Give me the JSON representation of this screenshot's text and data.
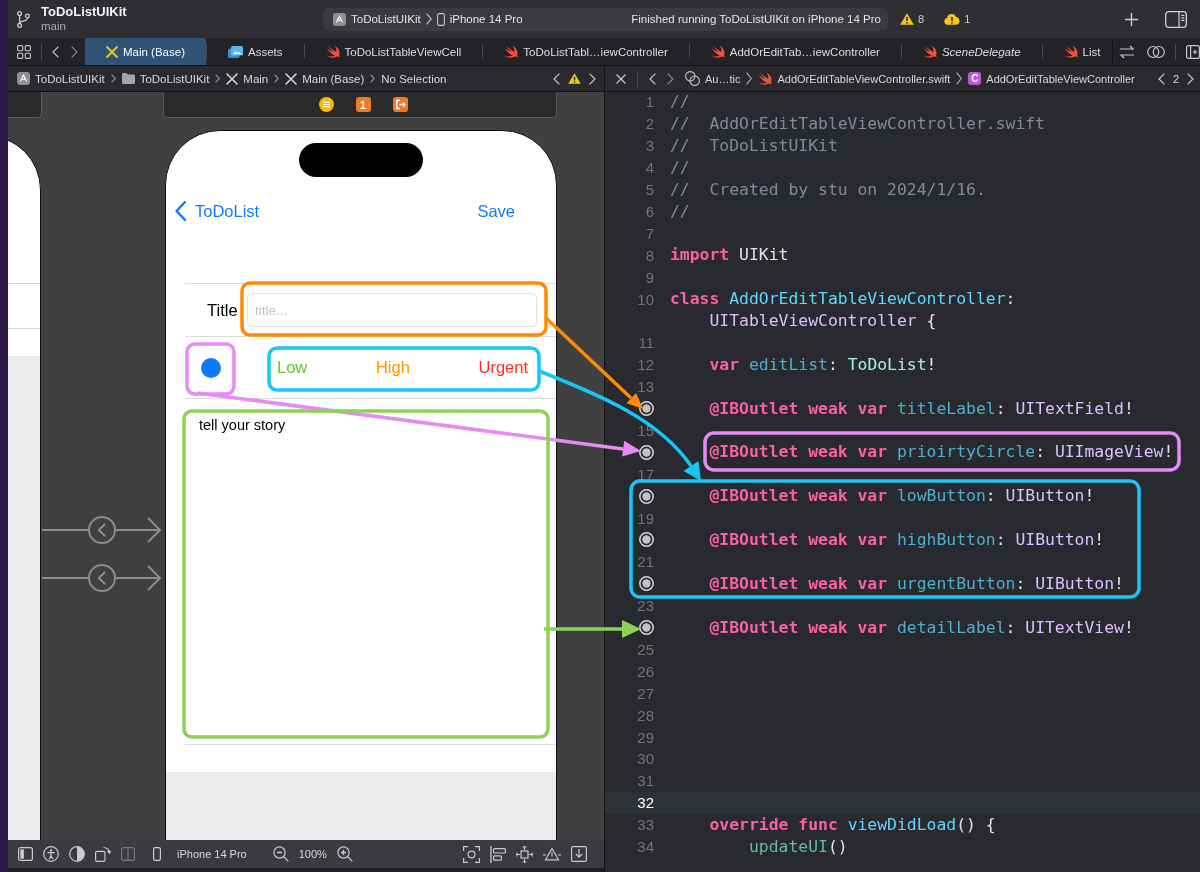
{
  "toolbar": {
    "project": "ToDoListUIKit",
    "branch": "main",
    "scheme": "ToDoListUIKit",
    "device": "iPhone 14 Pro",
    "status": "Finished running ToDoListUIKit on iPhone 14 Pro",
    "warnings": "8",
    "issues": "1"
  },
  "tabs": [
    {
      "label": "Main (Base)",
      "kind": "storyboard",
      "selected": true,
      "preview": false
    },
    {
      "label": "Assets",
      "kind": "assets",
      "selected": false,
      "preview": false
    },
    {
      "label": "ToDoListTableViewCell",
      "kind": "swift",
      "selected": false,
      "preview": false
    },
    {
      "label": "ToDoListTabl…iewController",
      "kind": "swift",
      "selected": false,
      "preview": false
    },
    {
      "label": "AddOrEditTab…iewController",
      "kind": "swift",
      "selected": false,
      "preview": false
    },
    {
      "label": "SceneDelegate",
      "kind": "swift",
      "selected": false,
      "preview": true
    },
    {
      "label": "List",
      "kind": "swift",
      "selected": false,
      "preview": false
    }
  ],
  "canvas_jump_bar": {
    "path": [
      {
        "kind": "app",
        "label": "ToDoListUIKit"
      },
      {
        "kind": "folder",
        "label": "ToDoListUIKit"
      },
      {
        "kind": "storyboard",
        "label": "Main"
      },
      {
        "kind": "storyboard",
        "label": "Main (Base)"
      },
      {
        "kind": "text",
        "label": "No Selection"
      }
    ]
  },
  "editor_jump_bar": {
    "path": [
      {
        "kind": "related",
        "label": "Au…tic"
      },
      {
        "kind": "swift",
        "label": "AddOrEditTableViewController.swift"
      },
      {
        "kind": "class",
        "badge": "C",
        "label": "AddOrEditTableViewController"
      }
    ],
    "counter": "2"
  },
  "canvas": {
    "scene_dock": [
      {
        "kind": "controller"
      },
      {
        "kind": "responder",
        "label": "1"
      },
      {
        "kind": "exit"
      }
    ],
    "screen": {
      "back_button": "ToDoList",
      "save_button": "Save",
      "title_label": "Title",
      "title_field": {
        "placeholder": "title..."
      },
      "priority_buttons": [
        {
          "label": "Low",
          "color": "#5fc82c"
        },
        {
          "label": "High",
          "color": "#ff9500"
        },
        {
          "label": "Urgent",
          "color": "#fe2c2c"
        }
      ],
      "story_field": {
        "value": "tell your story"
      }
    }
  },
  "bottom_bar": {
    "device": "iPhone 14 Pro",
    "zoom": "100%"
  },
  "code": {
    "lines": [
      {
        "kind": "numbered",
        "number": "1",
        "selected": false,
        "tokens": [
          {
            "kind": "comment",
            "text": "//"
          }
        ]
      },
      {
        "kind": "numbered",
        "number": "2",
        "selected": false,
        "tokens": [
          {
            "kind": "comment",
            "text": "//  AddOrEditTableViewController.swift"
          }
        ]
      },
      {
        "kind": "numbered",
        "number": "3",
        "selected": false,
        "tokens": [
          {
            "kind": "comment",
            "text": "//  ToDoListUIKit"
          }
        ]
      },
      {
        "kind": "numbered",
        "number": "4",
        "selected": false,
        "tokens": [
          {
            "kind": "comment",
            "text": "//"
          }
        ]
      },
      {
        "kind": "numbered",
        "number": "5",
        "selected": false,
        "tokens": [
          {
            "kind": "comment",
            "text": "//  Created by stu on 2024/1/16."
          }
        ]
      },
      {
        "kind": "numbered",
        "number": "6",
        "selected": false,
        "tokens": [
          {
            "kind": "comment",
            "text": "//"
          }
        ]
      },
      {
        "kind": "numbered",
        "number": "7",
        "selected": false
      },
      {
        "kind": "numbered",
        "number": "8",
        "selected": false,
        "tokens": [
          {
            "kind": "keyword",
            "text": "import"
          },
          {
            "kind": "plain",
            "text": " UIKit"
          }
        ]
      },
      {
        "kind": "numbered",
        "number": "9",
        "selected": false
      },
      {
        "kind": "numbered",
        "number": "10",
        "selected": false,
        "tokens": [
          {
            "kind": "keyword",
            "text": "class"
          },
          {
            "kind": "declaration",
            "text": " AddOrEditTableViewController"
          },
          {
            "kind": "plain",
            "text": ": "
          },
          {
            "kind": "type",
            "text": "UITableViewController"
          },
          {
            "kind": "plain",
            "text": " {"
          }
        ]
      },
      {
        "kind": "numbered",
        "number": "11",
        "selected": false
      },
      {
        "kind": "numbered",
        "number": "12",
        "selected": false,
        "tokens": [
          {
            "kind": "keyword",
            "text": "    var"
          },
          {
            "kind": "property",
            "text": " editList"
          },
          {
            "kind": "plain",
            "text": ": "
          },
          {
            "kind": "project_type",
            "text": "ToDoList"
          },
          {
            "kind": "plain",
            "text": "!"
          }
        ]
      },
      {
        "kind": "numbered",
        "number": "13",
        "selected": false
      },
      {
        "kind": "outlet",
        "selected": false,
        "tokens": [
          {
            "kind": "keyword",
            "text": "    @IBOutlet weak var"
          },
          {
            "kind": "property",
            "text": " titleLabel"
          },
          {
            "kind": "plain",
            "text": ": "
          },
          {
            "kind": "type",
            "text": "UITextField"
          },
          {
            "kind": "plain",
            "text": "!"
          }
        ]
      },
      {
        "kind": "numbered",
        "number": "15",
        "selected": false
      },
      {
        "kind": "outlet",
        "selected": false,
        "tokens": [
          {
            "kind": "keyword",
            "text": "    @IBOutlet weak var"
          },
          {
            "kind": "property",
            "text": " prioirtyCircle"
          },
          {
            "kind": "plain",
            "text": ": "
          },
          {
            "kind": "type",
            "text": "UIImageView"
          },
          {
            "kind": "plain",
            "text": "!"
          }
        ]
      },
      {
        "kind": "numbered",
        "number": "17",
        "selected": false
      },
      {
        "kind": "outlet",
        "selected": false,
        "tokens": [
          {
            "kind": "keyword",
            "text": "    @IBOutlet weak var"
          },
          {
            "kind": "property",
            "text": " lowButton"
          },
          {
            "kind": "plain",
            "text": ": "
          },
          {
            "kind": "type",
            "text": "UIButton"
          },
          {
            "kind": "plain",
            "text": "!"
          }
        ]
      },
      {
        "kind": "numbered",
        "number": "19",
        "selected": false
      },
      {
        "kind": "outlet",
        "selected": false,
        "tokens": [
          {
            "kind": "keyword",
            "text": "    @IBOutlet weak var"
          },
          {
            "kind": "property",
            "text": " highButton"
          },
          {
            "kind": "plain",
            "text": ": "
          },
          {
            "kind": "type",
            "text": "UIButton"
          },
          {
            "kind": "plain",
            "text": "!"
          }
        ]
      },
      {
        "kind": "numbered",
        "number": "21",
        "selected": false
      },
      {
        "kind": "outlet",
        "selected": false,
        "tokens": [
          {
            "kind": "keyword",
            "text": "    @IBOutlet weak var"
          },
          {
            "kind": "property",
            "text": " urgentButton"
          },
          {
            "kind": "plain",
            "text": ": "
          },
          {
            "kind": "type",
            "text": "UIButton"
          },
          {
            "kind": "plain",
            "text": "!"
          }
        ]
      },
      {
        "kind": "numbered",
        "number": "23",
        "selected": false
      },
      {
        "kind": "outlet",
        "selected": false,
        "tokens": [
          {
            "kind": "keyword",
            "text": "    @IBOutlet weak var"
          },
          {
            "kind": "property",
            "text": " detailLabel"
          },
          {
            "kind": "plain",
            "text": ": "
          },
          {
            "kind": "type",
            "text": "UITextView"
          },
          {
            "kind": "plain",
            "text": "!"
          }
        ]
      },
      {
        "kind": "numbered",
        "number": "25",
        "selected": false
      },
      {
        "kind": "numbered",
        "number": "26",
        "selected": false
      },
      {
        "kind": "numbered",
        "number": "27",
        "selected": false
      },
      {
        "kind": "numbered",
        "number": "28",
        "selected": false
      },
      {
        "kind": "numbered",
        "number": "29",
        "selected": false
      },
      {
        "kind": "numbered",
        "number": "30",
        "selected": false
      },
      {
        "kind": "numbered",
        "number": "31",
        "selected": false
      },
      {
        "kind": "numbered",
        "number": "32",
        "selected": true
      },
      {
        "kind": "numbered",
        "number": "33",
        "selected": false,
        "tokens": [
          {
            "kind": "keyword",
            "text": "    override func"
          },
          {
            "kind": "declaration",
            "text": " viewDidLoad"
          },
          {
            "kind": "plain",
            "text": "() {"
          }
        ]
      },
      {
        "kind": "numbered",
        "number": "34",
        "selected": false,
        "tokens": [
          {
            "kind": "project_function",
            "text": "        updateUI"
          },
          {
            "kind": "plain",
            "text": "()"
          }
        ]
      }
    ]
  },
  "callouts": [
    {
      "color": "#ff8c00"
    },
    {
      "color": "#e68af4"
    },
    {
      "color": "#17c6f3"
    },
    {
      "color": "#8fd156"
    }
  ]
}
